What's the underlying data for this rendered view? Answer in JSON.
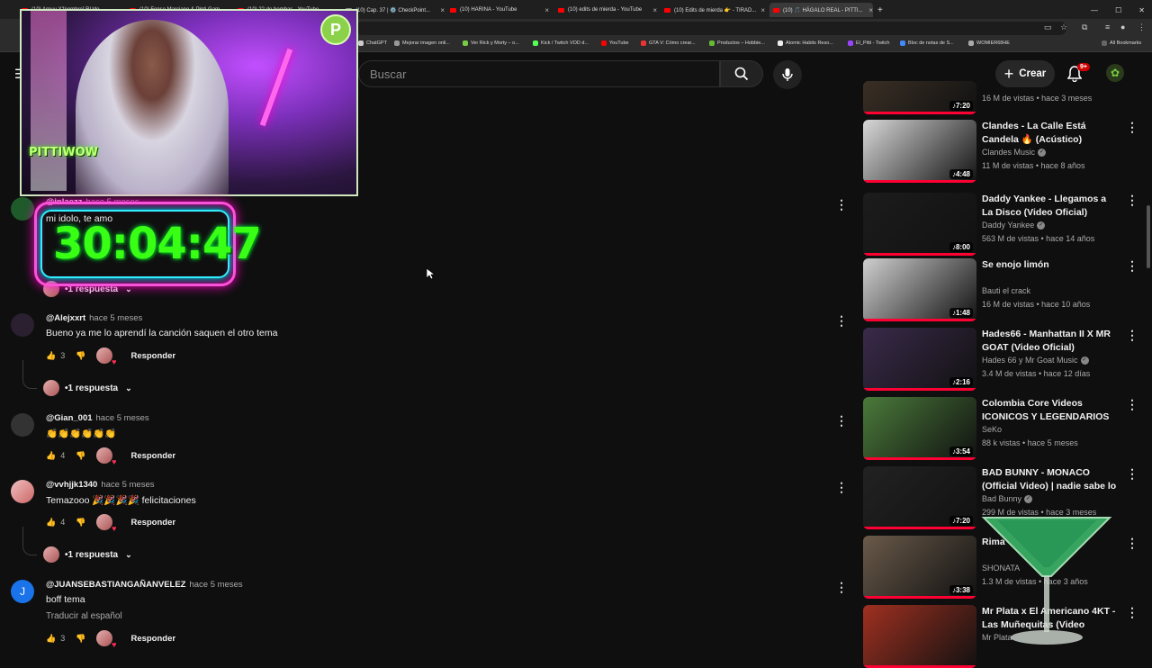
{
  "browser": {
    "tabs": [
      {
        "label": "(10) Arpuu X'[nombre] RUdo...",
        "x": 0
      },
      {
        "label": "(10) Fonso Marciano & Pinti Gam...",
        "x": 0
      },
      {
        "label": "(10) 22 de bombas - YouTube",
        "x": 0
      },
      {
        "label": "(10) Cap. 37 | ⚙️ CheckPoint...",
        "x": 0
      },
      {
        "label": "(10) HARINA - YouTube",
        "x": 0
      },
      {
        "label": "(10) edits de mierda - YouTube",
        "x": 0
      },
      {
        "label": "(10) Edits de mierda 👉 - TIRAD...",
        "x": 0
      },
      {
        "label": "(10) 🎵 HÁGALO REAL - PITTI...",
        "x": 0
      }
    ],
    "bookmarks": [
      "ChatGPT",
      "Mejorar imagen onli...",
      "Ver Rick y Morty – o...",
      "Kick / Twitch VOD d...",
      "YouTube",
      "GTA V: Cómo crear...",
      "Productos – Hobbie...",
      "Atomic Habits Reso...",
      "El_Pitti - Twitch",
      "Bloc de notas de S...",
      "WOMIER68HE",
      "All Bookmarks"
    ]
  },
  "header": {
    "search_placeholder": "Buscar",
    "create_label": "Crear",
    "notif_count": "9+"
  },
  "overlay": {
    "brand": "PITTIWOW",
    "logo_letter": "P",
    "timer": "30:04:47"
  },
  "comments": [
    {
      "author": "@inlaezz",
      "time": "hace 5 meses",
      "text": "mi idolo, te amo",
      "likes": "",
      "replies": "1 respuesta",
      "reply_label": "Responder"
    },
    {
      "author": "@Alejxxrt",
      "time": "hace 5 meses",
      "text": "Bueno ya me lo aprendí la canción saquen el otro tema",
      "likes": "3",
      "replies": "1 respuesta",
      "reply_label": "Responder"
    },
    {
      "author": "@Gian_001",
      "time": "hace 5 meses",
      "text": "👏👏👏👏👏👏",
      "likes": "4",
      "replies": "",
      "reply_label": "Responder"
    },
    {
      "author": "@vvhjjk1340",
      "time": "hace 5 meses",
      "text": "Temazooo 🎉🎉🎉🎉 felicitaciones",
      "likes": "4",
      "replies": "1 respuesta",
      "reply_label": "Responder"
    },
    {
      "author": "@JUANSEBASTIANGAÑANVELEZ",
      "time": "hace 5 meses",
      "text": "boff tema",
      "translate": "Traducir al español",
      "likes": "3",
      "replies": "",
      "reply_label": "Responder",
      "avatar_letter": "J"
    }
  ],
  "videos": [
    {
      "title": "",
      "channel": "",
      "meta": "16 M de vistas • hace 3 meses",
      "duration": "7:20",
      "verified": false
    },
    {
      "title": "Clandes - La Calle Está Candela 🔥 (Acústico)",
      "channel": "Clandes Music",
      "meta": "11 M de vistas • hace 8 años",
      "duration": "4:48",
      "verified": true
    },
    {
      "title": "Daddy Yankee - Llegamos a La Disco (Video Oficial)",
      "channel": "Daddy Yankee",
      "meta": "563 M de vistas • hace 14 años",
      "duration": "8:00",
      "verified": true
    },
    {
      "title": "Se enojo limón",
      "channel": "Bauti el crack",
      "meta": "16 M de vistas • hace 10 años",
      "duration": "1:48",
      "verified": false
    },
    {
      "title": "Hades66 - Manhattan II X MR GOAT (Video Oficial)",
      "channel": "Hades 66 y Mr Goat Music",
      "meta": "3.4 M de vistas • hace 12 días",
      "duration": "2:16",
      "verified": true
    },
    {
      "title": "Colombia Core Videos ICONICOS Y LEGENDARIOS #2",
      "channel": "SeKo",
      "meta": "88 k vistas • hace 5 meses",
      "duration": "3:54",
      "verified": false
    },
    {
      "title": "BAD BUNNY - MONACO (Official Video) | nadie sabe lo que va a...",
      "channel": "Bad Bunny",
      "meta": "299 M de vistas • hace 3 meses",
      "duration": "7:20",
      "verified": true
    },
    {
      "title": "Rima",
      "channel": "SHONATA",
      "meta": "1.3 M de vistas • hace 3 años",
      "duration": "3:38",
      "verified": false
    },
    {
      "title": "Mr Plata x El Americano 4KT - Las Muñequitas (Video Oficial)",
      "channel": "Mr Plata",
      "meta": "",
      "duration": "",
      "verified": false
    }
  ],
  "thumb_colors": [
    "#3a2f25",
    "#d8d8d8",
    "#1c1c1c",
    "#cfcfcf",
    "#3a2a4a",
    "#4a7a3a",
    "#222",
    "#6a5a4a",
    "#a03020"
  ]
}
